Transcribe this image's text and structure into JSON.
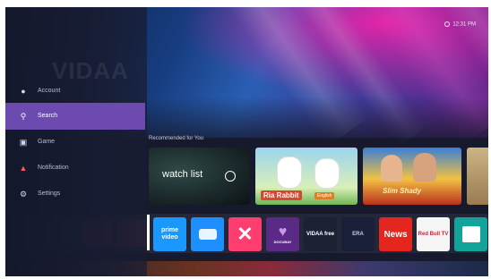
{
  "status": {
    "time": "12:31 PM"
  },
  "sidebar": {
    "logo": "VIDAA",
    "items": [
      {
        "label": "Account",
        "icon": "person-icon",
        "active": false
      },
      {
        "label": "Search",
        "icon": "search-icon",
        "active": true
      },
      {
        "label": "Game",
        "icon": "gamepad-icon",
        "active": false
      },
      {
        "label": "Notification",
        "icon": "bell-icon",
        "active": false
      },
      {
        "label": "Settings",
        "icon": "gear-icon",
        "active": false
      }
    ]
  },
  "main": {
    "section_title": "Recommended for You",
    "cards": [
      {
        "title": "watch list",
        "icon": "play-icon"
      },
      {
        "title": "Ria Rabbit",
        "subtitle": "English"
      },
      {
        "title": "Slim Shady"
      },
      {
        "title": ""
      }
    ],
    "apps": [
      {
        "label": "prime video",
        "icon": "prime-video-icon",
        "color": "#1a98ff"
      },
      {
        "label": "",
        "icon": "hisense-app-icon",
        "color": "#1e8fff"
      },
      {
        "label": "",
        "icon": "x-app-icon",
        "color": "#ff3d6e"
      },
      {
        "label": "DOCUBAY",
        "icon": "heart-icon",
        "color": "#5b2a86"
      },
      {
        "label": "VIDAA free",
        "icon": "vidaa-free-icon",
        "color": "#1c2233"
      },
      {
        "label": "ERA",
        "icon": "era-icon",
        "color": "#1a1f3a"
      },
      {
        "label": "News",
        "icon": "news-icon",
        "color": "#e5261f"
      },
      {
        "label": "Red Bull TV",
        "icon": "redbull-icon",
        "color": "#f5f5f5"
      },
      {
        "label": "",
        "icon": "book-app-icon",
        "color": "#12a39a"
      },
      {
        "label": "",
        "icon": "partial-app-icon",
        "color": "#ffffff"
      }
    ]
  },
  "colors": {
    "accent": "#6c4ab0",
    "background": "#161a2c"
  }
}
